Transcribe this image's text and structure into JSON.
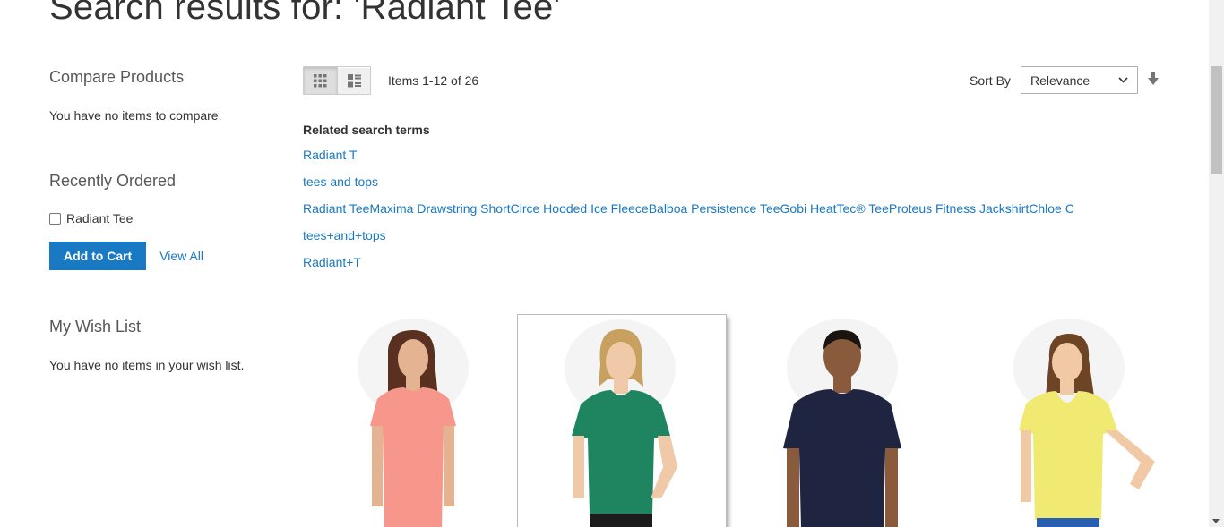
{
  "page": {
    "title": "Search results for: 'Radiant Tee'"
  },
  "sidebar": {
    "compare": {
      "title": "Compare Products",
      "empty": "You have no items to compare."
    },
    "recently_ordered": {
      "title": "Recently Ordered",
      "items": [
        {
          "name": "Radiant Tee",
          "checked": false
        }
      ],
      "add_to_cart": "Add to Cart",
      "view_all": "View All"
    },
    "wishlist": {
      "title": "My Wish List",
      "empty": "You have no items in your wish list."
    }
  },
  "toolbar": {
    "modes": [
      {
        "name": "Grid",
        "icon": "grid-icon",
        "active": true
      },
      {
        "name": "List",
        "icon": "list-icon",
        "active": false
      }
    ],
    "amount": "Items 1-12 of 26",
    "sort_label": "Sort By",
    "sort_value": "Relevance",
    "sort_direction_icon": "arrow-down-icon"
  },
  "related": {
    "title": "Related search terms",
    "terms": [
      "Radiant T",
      "tees and tops",
      "Radiant TeeMaxima Drawstring ShortCirce Hooded Ice FleeceBalboa Persistence TeeGobi HeatTec® TeeProteus Fitness JackshirtChloe C",
      "tees+and+tops",
      "Radiant+T"
    ]
  },
  "products": [
    {
      "shirt_color": "#f7968a",
      "skin": "#e4b392",
      "hair": "#5a3020",
      "hovered": false
    },
    {
      "shirt_color": "#1e8560",
      "skin": "#f0c9a8",
      "hair": "#c8a060",
      "hovered": true
    },
    {
      "shirt_color": "#1f2540",
      "skin": "#8a5a3c",
      "hair": "#1a1410",
      "hovered": false
    },
    {
      "shirt_color": "#f0ea72",
      "skin": "#f1c9a5",
      "hair": "#6e4426",
      "hovered": false
    }
  ],
  "colors": {
    "link": "#1979c3",
    "primary_button": "#1979c3"
  }
}
